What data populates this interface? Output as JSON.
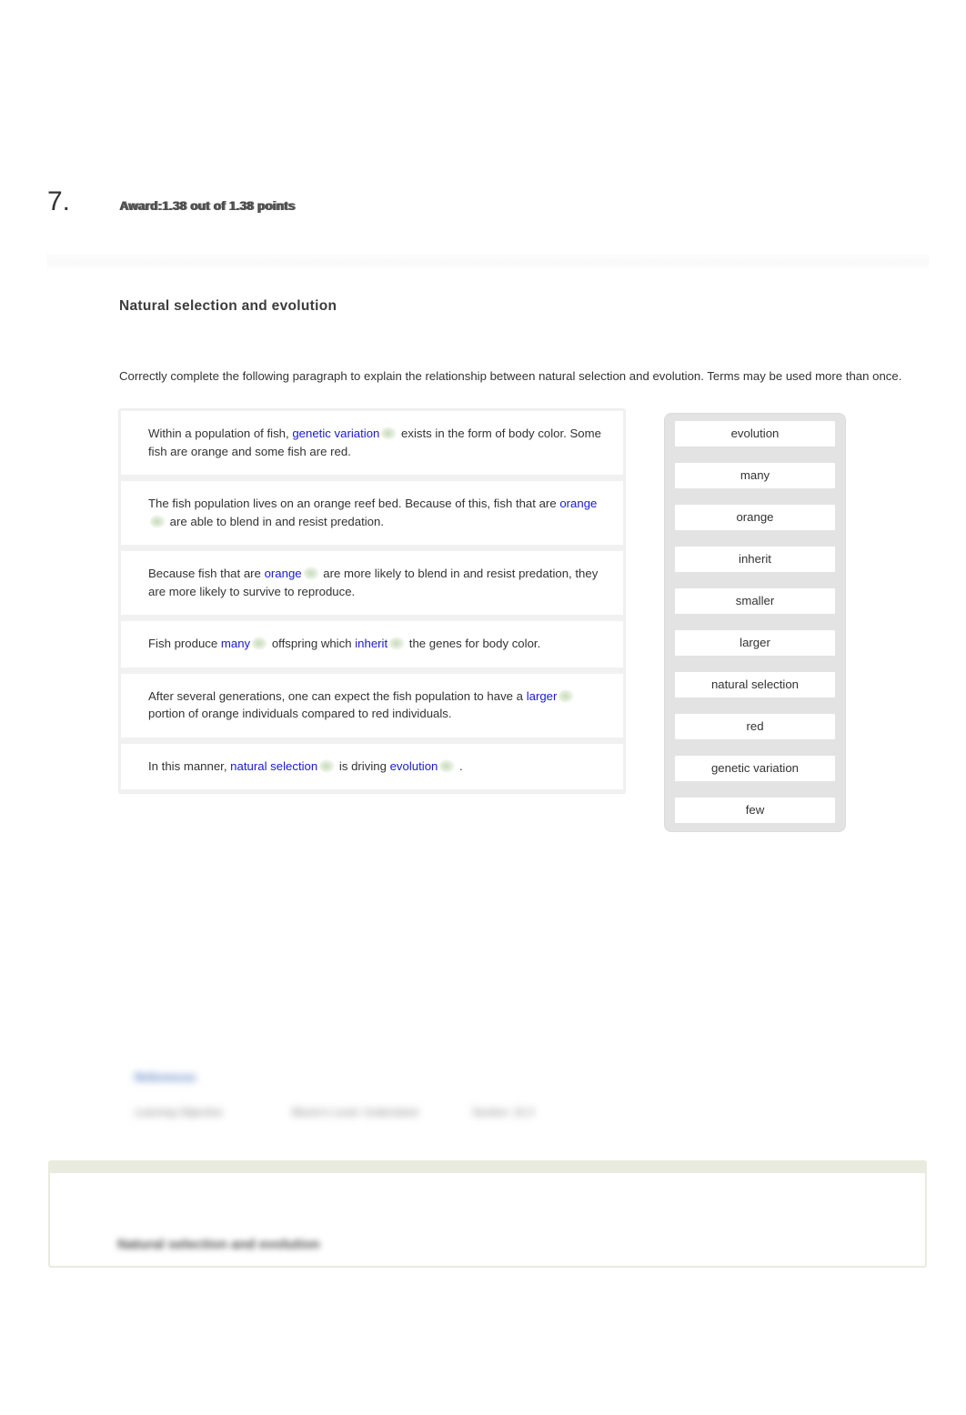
{
  "question": {
    "number": "7.",
    "award_label": "Award:",
    "award_text": "1.38 out of 1.38 points",
    "title": "Natural selection and evolution",
    "instructions": "Correctly complete the following paragraph to explain the relationship between natural selection and evolution. Terms may be used more than once."
  },
  "sentences": [
    {
      "pre": "Within a population of fish, ",
      "answer1": "genetic variation",
      "mid": " exists in the form of body color. Some fish are orange and some fish are red.",
      "answer2": "",
      "post": ""
    },
    {
      "pre": "The fish population lives on an orange reef bed. Because of this, fish that are ",
      "answer1": "orange",
      "mid": " are able to blend in and resist predation.",
      "answer2": "",
      "post": ""
    },
    {
      "pre": "Because fish that are ",
      "answer1": "orange",
      "mid": " are more likely to blend in and resist predation, they are more likely to survive to reproduce.",
      "answer2": "",
      "post": ""
    },
    {
      "pre": "Fish produce ",
      "answer1": "many",
      "mid": " offspring which ",
      "answer2": "inherit",
      "post": " the genes for body color."
    },
    {
      "pre": "After several generations, one can expect the fish population to have a ",
      "answer1": "larger",
      "mid": " portion of orange individuals compared to red individuals.",
      "answer2": "",
      "post": ""
    },
    {
      "pre": "In this manner, ",
      "answer1": "natural selection",
      "mid": " is driving ",
      "answer2": "evolution",
      "post": " ."
    }
  ],
  "word_bank": [
    "evolution",
    "many",
    "orange",
    "inherit",
    "smaller",
    "larger",
    "natural selection",
    "red",
    "genetic variation",
    "few"
  ],
  "footer": {
    "references_link": "References",
    "meta_columns": [
      "Learning Objective",
      "Bloom's Level: Understand",
      "Section: 15.3"
    ]
  },
  "explanation": {
    "title": "Natural selection and evolution"
  },
  "colors": {
    "answer_blue": "#1a19d6",
    "correct_green": "#78a858",
    "word_bank_bg": "#e3e3e3",
    "sentence_stack_bg": "#f1f1f1",
    "explain_border": "#e8ebdd"
  }
}
